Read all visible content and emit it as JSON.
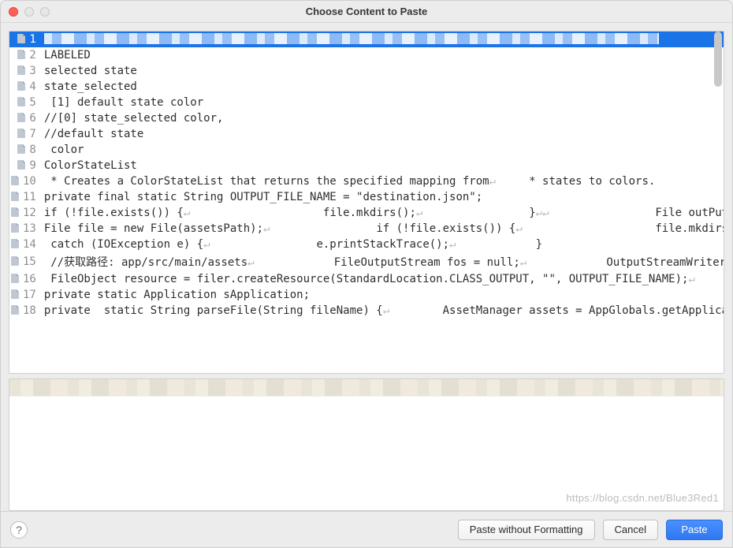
{
  "window": {
    "title": "Choose Content to Paste"
  },
  "list": {
    "selected_index": 0,
    "rows": [
      {
        "n": "1",
        "text": ""
      },
      {
        "n": "2",
        "text": "LABELED"
      },
      {
        "n": "3",
        "text": "selected state"
      },
      {
        "n": "4",
        "text": "state_selected"
      },
      {
        "n": "5",
        "text": " [1] default state color"
      },
      {
        "n": "6",
        "text": "//[0] state_selected color,"
      },
      {
        "n": "7",
        "text": "//default state"
      },
      {
        "n": "8",
        "text": " color"
      },
      {
        "n": "9",
        "text": "ColorStateList"
      },
      {
        "n": "10",
        "text": " * Creates a ColorStateList that returns the specified mapping from↵     * states to colors."
      },
      {
        "n": "11",
        "text": "private final static String OUTPUT_FILE_NAME = \"destination.json\";"
      },
      {
        "n": "12",
        "text": "if (!file.exists()) {↵                    file.mkdirs();↵                }↵↵                File outPut"
      },
      {
        "n": "13",
        "text": "File file = new File(assetsPath);↵                if (!file.exists()) {↵                    file.mkdirs"
      },
      {
        "n": "14",
        "text": " catch (IOException e) {↵                e.printStackTrace();↵            }"
      },
      {
        "n": "15",
        "text": " //获取路径: app/src/main/assets↵            FileOutputStream fos = null;↵            OutputStreamWriter"
      },
      {
        "n": "16",
        "text": " FileObject resource = filer.createResource(StandardLocation.CLASS_OUTPUT, \"\", OUTPUT_FILE_NAME);↵"
      },
      {
        "n": "17",
        "text": "private static Application sApplication;"
      },
      {
        "n": "18",
        "text": "private  static String parseFile(String fileName) {↵        AssetManager assets = AppGlobals.getApplica"
      }
    ]
  },
  "buttons": {
    "paste_plain": "Paste without Formatting",
    "cancel": "Cancel",
    "paste": "Paste"
  },
  "watermark": "https://blog.csdn.net/Blue3Red1"
}
